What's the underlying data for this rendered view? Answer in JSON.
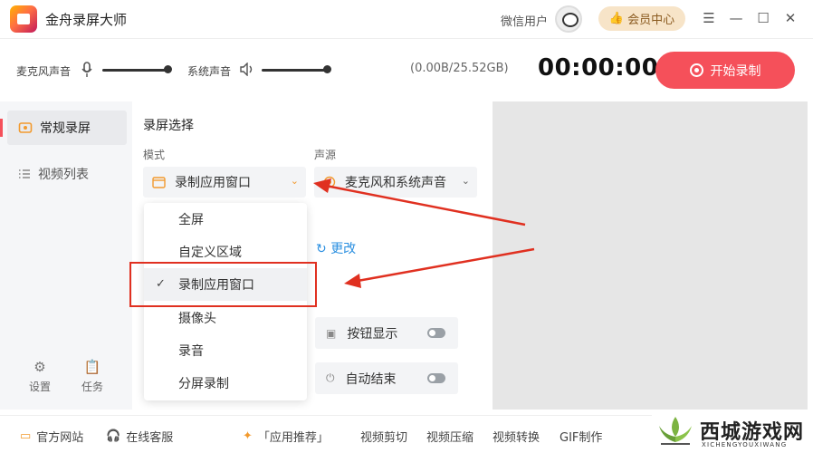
{
  "app": {
    "title": "金舟录屏大师"
  },
  "titlebar": {
    "user_name": "微信用户",
    "vip_label": "会员中心",
    "menu_icon": "menu-icon",
    "min_icon": "minimize-icon",
    "max_icon": "maximize-icon",
    "close_icon": "close-icon"
  },
  "audio": {
    "mic_label": "麦克风声音",
    "system_label": "系统声音",
    "mic_level": 1.0,
    "system_level": 1.0
  },
  "status": {
    "storage": "(0.00B/25.52GB)",
    "timer": "00:00:00",
    "start_label": "开始录制"
  },
  "sidebar": {
    "items": [
      {
        "label": "常规录屏",
        "icon": "record-icon",
        "active": true
      },
      {
        "label": "视频列表",
        "icon": "list-icon",
        "active": false
      }
    ],
    "tools": [
      {
        "label": "设置",
        "icon": "gear-icon"
      },
      {
        "label": "任务",
        "icon": "clipboard-icon"
      }
    ]
  },
  "main": {
    "section_title": "录屏选择",
    "mode_label": "模式",
    "mode_value": "录制应用窗口",
    "source_label": "声源",
    "source_value": "麦克风和系统声音",
    "change_label": "更改",
    "toggles": [
      {
        "label": "按钮显示",
        "on": false
      },
      {
        "label": "自动结束",
        "on": false
      }
    ]
  },
  "dropdown": {
    "options": [
      "全屏",
      "自定义区域",
      "录制应用窗口",
      "摄像头",
      "录音",
      "分屏录制"
    ],
    "selected": "录制应用窗口",
    "check_glyph": "✓"
  },
  "bottom": {
    "website": "官方网站",
    "support": "在线客服",
    "recommend": "「应用推荐」",
    "tools": [
      "视频剪切",
      "视频压缩",
      "视频转换",
      "GIF制作"
    ]
  },
  "watermark": {
    "text": "西城游戏网",
    "sub": "XICHENGYOUXIWANG"
  },
  "colors": {
    "accent": "#f5505a",
    "link": "#2a8fe0",
    "annotation": "#e03020",
    "vip_bg": "#f7e4c8"
  }
}
